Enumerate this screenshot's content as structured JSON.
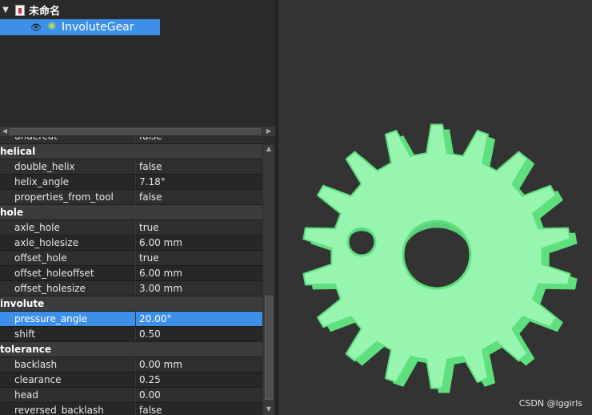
{
  "tree": {
    "root_label": "未命名",
    "item_label": "InvoluteGear"
  },
  "properties": {
    "rows": [
      {
        "kind": "cut",
        "name": "undercut",
        "value": "false"
      },
      {
        "kind": "group",
        "name": "helical"
      },
      {
        "kind": "prop",
        "name": "double_helix",
        "value": "false"
      },
      {
        "kind": "prop",
        "name": "helix_angle",
        "value": "7.18°"
      },
      {
        "kind": "prop",
        "name": "properties_from_tool",
        "value": "false"
      },
      {
        "kind": "group",
        "name": "hole"
      },
      {
        "kind": "prop",
        "name": "axle_hole",
        "value": "true"
      },
      {
        "kind": "prop",
        "name": "axle_holesize",
        "value": "6.00 mm"
      },
      {
        "kind": "prop",
        "name": "offset_hole",
        "value": "true"
      },
      {
        "kind": "prop",
        "name": "offset_holeoffset",
        "value": "6.00 mm"
      },
      {
        "kind": "prop",
        "name": "offset_holesize",
        "value": "3.00 mm"
      },
      {
        "kind": "group",
        "name": "involute"
      },
      {
        "kind": "prop",
        "name": "pressure_angle",
        "value": "20.00°",
        "selected": true
      },
      {
        "kind": "prop",
        "name": "shift",
        "value": "0.50"
      },
      {
        "kind": "group",
        "name": "tolerance"
      },
      {
        "kind": "prop",
        "name": "backlash",
        "value": "0.00 mm"
      },
      {
        "kind": "prop",
        "name": "clearance",
        "value": "0.25"
      },
      {
        "kind": "prop",
        "name": "head",
        "value": "0.00"
      },
      {
        "kind": "prop",
        "name": "reversed_backlash",
        "value": "false"
      }
    ]
  },
  "view": {
    "gear_color": "#98f5b0",
    "gear_edge_color": "#5ee07e",
    "gear_teeth": 18,
    "watermark": "CSDN @lggirls"
  },
  "colors": {
    "selection": "#3d8fe8",
    "background_view": "#333333"
  }
}
